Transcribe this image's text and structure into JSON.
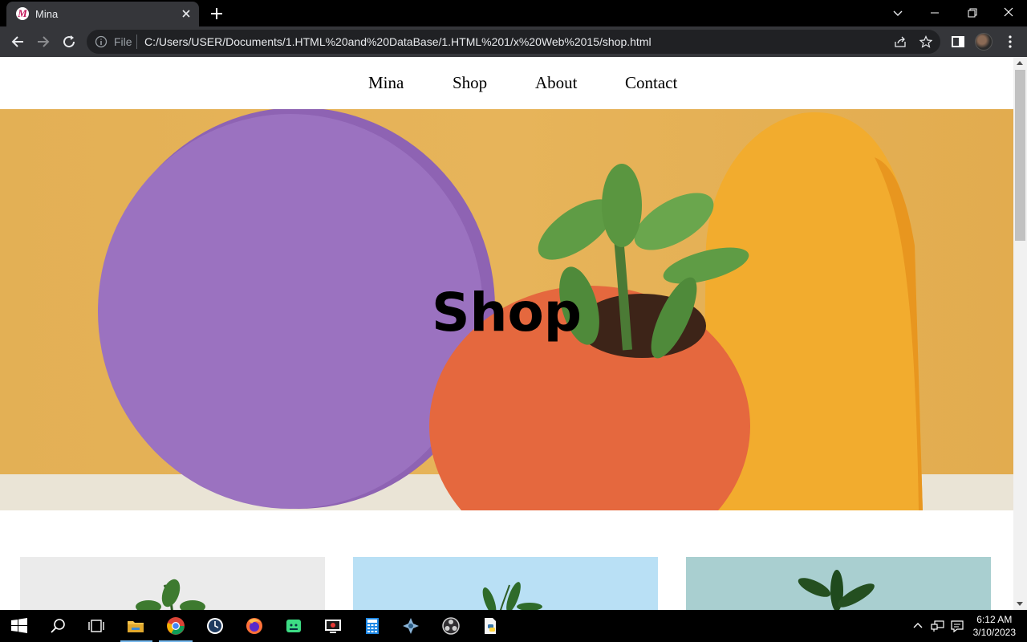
{
  "browser": {
    "tab_title": "Mina",
    "favicon_letter": "M",
    "omnibox": {
      "security_label": "File",
      "url": "C:/Users/USER/Documents/1.HTML%20and%20DataBase/1.HTML%201/x%20Web%2015/shop.html"
    }
  },
  "site": {
    "nav": [
      "Mina",
      "Shop",
      "About",
      "Contact"
    ],
    "hero_title": "Shop"
  },
  "products": [
    {
      "icon": "plant-image",
      "bg": "#ebebeb"
    },
    {
      "icon": "plant-image",
      "bg": "#b9e0f5"
    },
    {
      "icon": "plant-image",
      "bg": "#a9cfd0"
    }
  ],
  "taskbar": {
    "time": "6:12 AM",
    "date": "3/10/2023"
  },
  "colors": {
    "chrome_dark": "#35363a",
    "hero_bg": "#e3b055",
    "purple_disc": "#9b72c0",
    "orange_pot": "#e5683e",
    "yellow_vase": "#f2ac2e",
    "taskbar_accent": "#76b9ed"
  }
}
